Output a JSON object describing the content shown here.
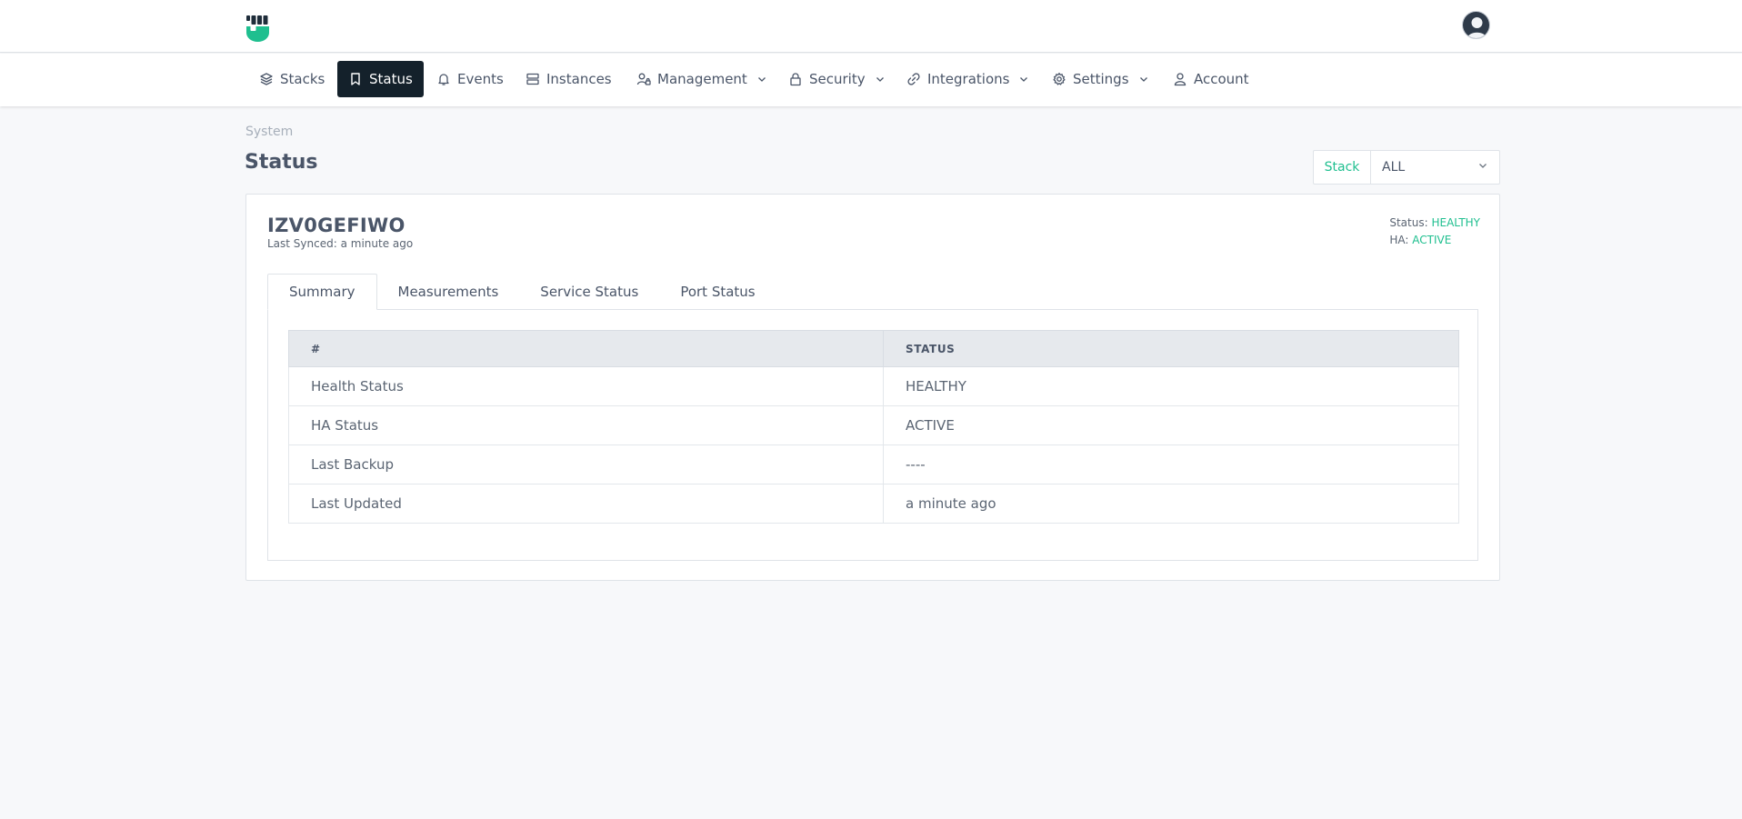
{
  "nav": {
    "items": [
      {
        "label": "Stacks",
        "icon": "layers-icon"
      },
      {
        "label": "Status",
        "icon": "bookmark-icon"
      },
      {
        "label": "Events",
        "icon": "bell-icon"
      },
      {
        "label": "Instances",
        "icon": "server-icon"
      },
      {
        "label": "Management",
        "icon": "user-lock-icon"
      },
      {
        "label": "Security",
        "icon": "lock-icon"
      },
      {
        "label": "Integrations",
        "icon": "link-icon"
      },
      {
        "label": "Settings",
        "icon": "gear-icon"
      },
      {
        "label": "Account",
        "icon": "user-icon"
      }
    ],
    "active": "Status"
  },
  "breadcrumb": "System",
  "page_title": "Status",
  "stack_filter": {
    "label": "Stack",
    "value": "ALL"
  },
  "card": {
    "title": "IZV0GEFIWO",
    "last_synced": "Last Synced: a minute ago",
    "status_label": "Status:",
    "status_value": "HEALTHY",
    "ha_label": "HA:",
    "ha_value": "ACTIVE"
  },
  "tabs": [
    "Summary",
    "Measurements",
    "Service Status",
    "Port Status"
  ],
  "table": {
    "headers": [
      "#",
      "STATUS"
    ],
    "rows": [
      [
        "Health Status",
        "HEALTHY"
      ],
      [
        "HA Status",
        "ACTIVE"
      ],
      [
        "Last Backup",
        "----"
      ],
      [
        "Last Updated",
        "a minute ago"
      ]
    ]
  },
  "colors": {
    "accent": "#1fbf8f",
    "nav_active_bg": "#14212b"
  }
}
